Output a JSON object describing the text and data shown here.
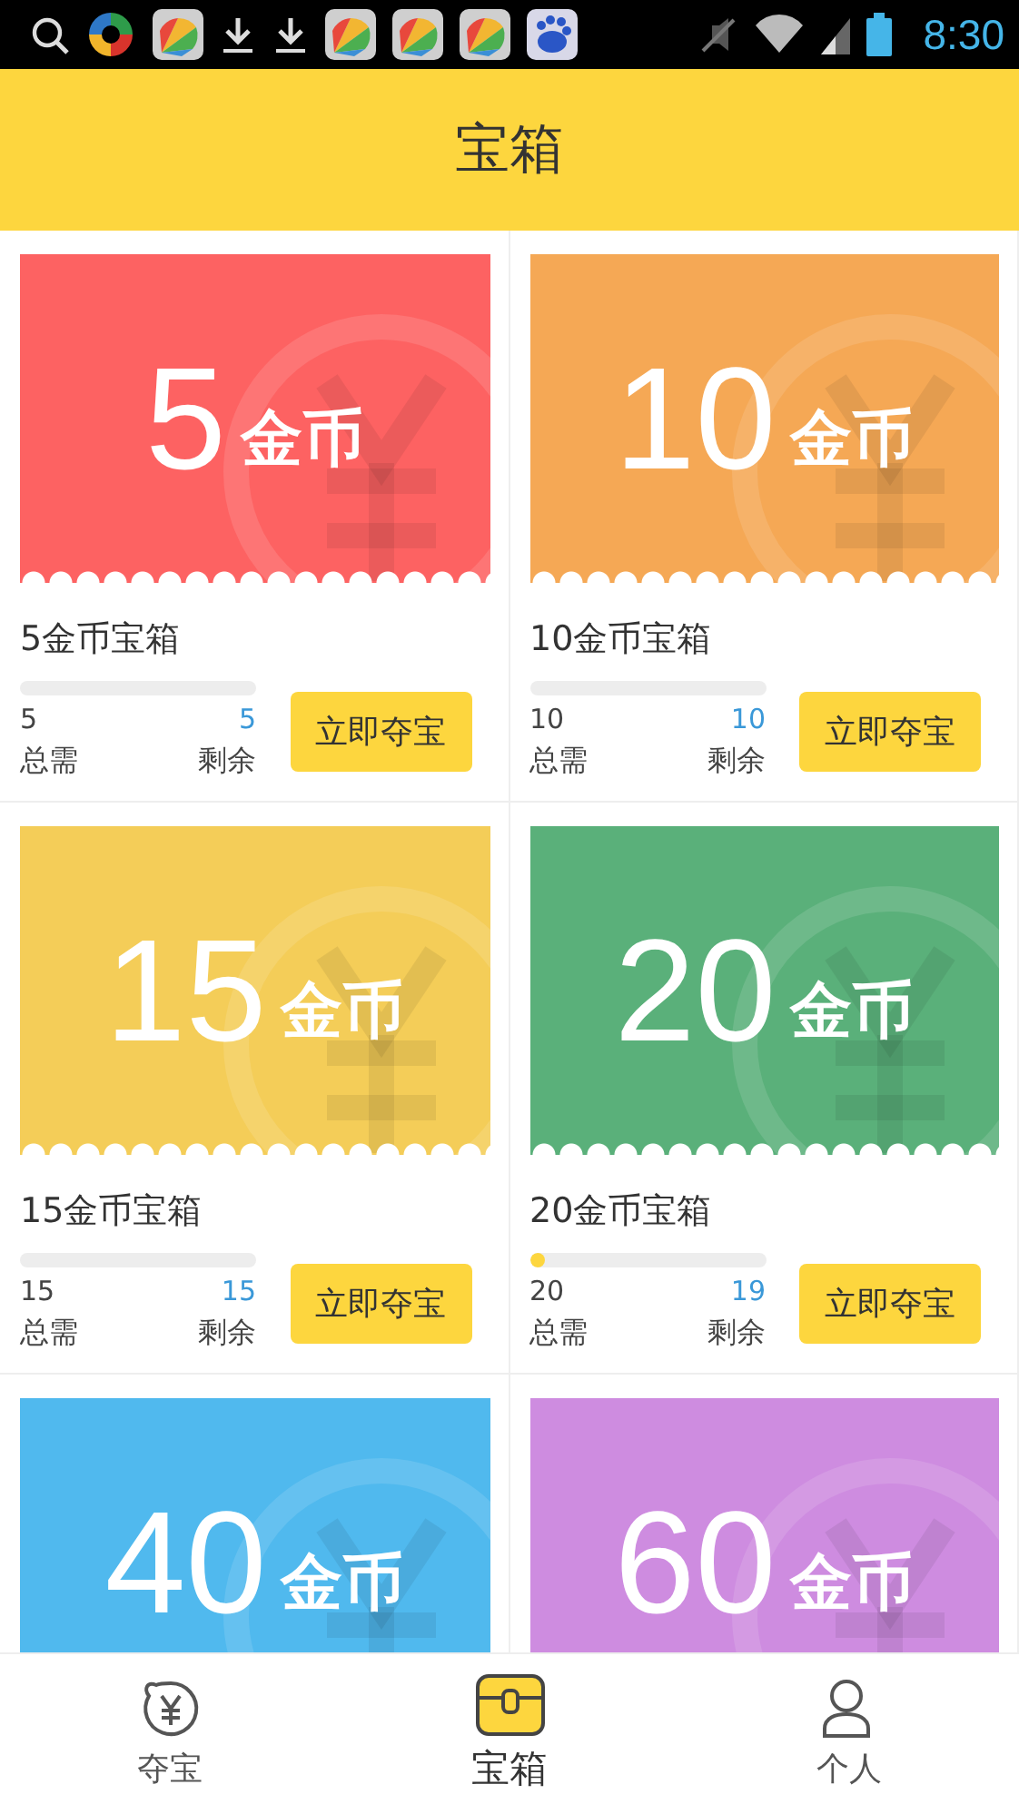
{
  "status_bar": {
    "time": "8:30"
  },
  "header": {
    "title": "宝箱"
  },
  "cards": [
    {
      "amount": "5",
      "unit": "金币",
      "color": "#fd6262",
      "title": "5金币宝箱",
      "level": 0,
      "total": "5",
      "remaining": "5",
      "total_label": "总需",
      "remaining_label": "剩余",
      "button": "立即夺宝"
    },
    {
      "amount": "10",
      "unit": "金币",
      "color": "#f5a855",
      "title": "10金币宝箱",
      "level": 0,
      "total": "10",
      "remaining": "10",
      "total_label": "总需",
      "remaining_label": "剩余",
      "button": "立即夺宝"
    },
    {
      "amount": "15",
      "unit": "金币",
      "color": "#f4cd58",
      "title": "15金币宝箱",
      "level": 0,
      "total": "15",
      "remaining": "15",
      "total_label": "总需",
      "remaining_label": "剩余",
      "button": "立即夺宝"
    },
    {
      "amount": "20",
      "unit": "金币",
      "color": "#5ab07a",
      "title": "20金币宝箱",
      "level": 0.05,
      "total": "20",
      "remaining": "19",
      "total_label": "总需",
      "remaining_label": "剩余",
      "button": "立即夺宝"
    },
    {
      "amount": "40",
      "unit": "金币",
      "color": "#50b9ee"
    },
    {
      "amount": "60",
      "unit": "金币",
      "color": "#ce8ce0"
    }
  ],
  "tabs": [
    {
      "label": "夺宝",
      "kind": "coin",
      "selected": false
    },
    {
      "label": "宝箱",
      "kind": "chest",
      "selected": true
    },
    {
      "label": "个人",
      "kind": "person",
      "selected": false
    }
  ]
}
